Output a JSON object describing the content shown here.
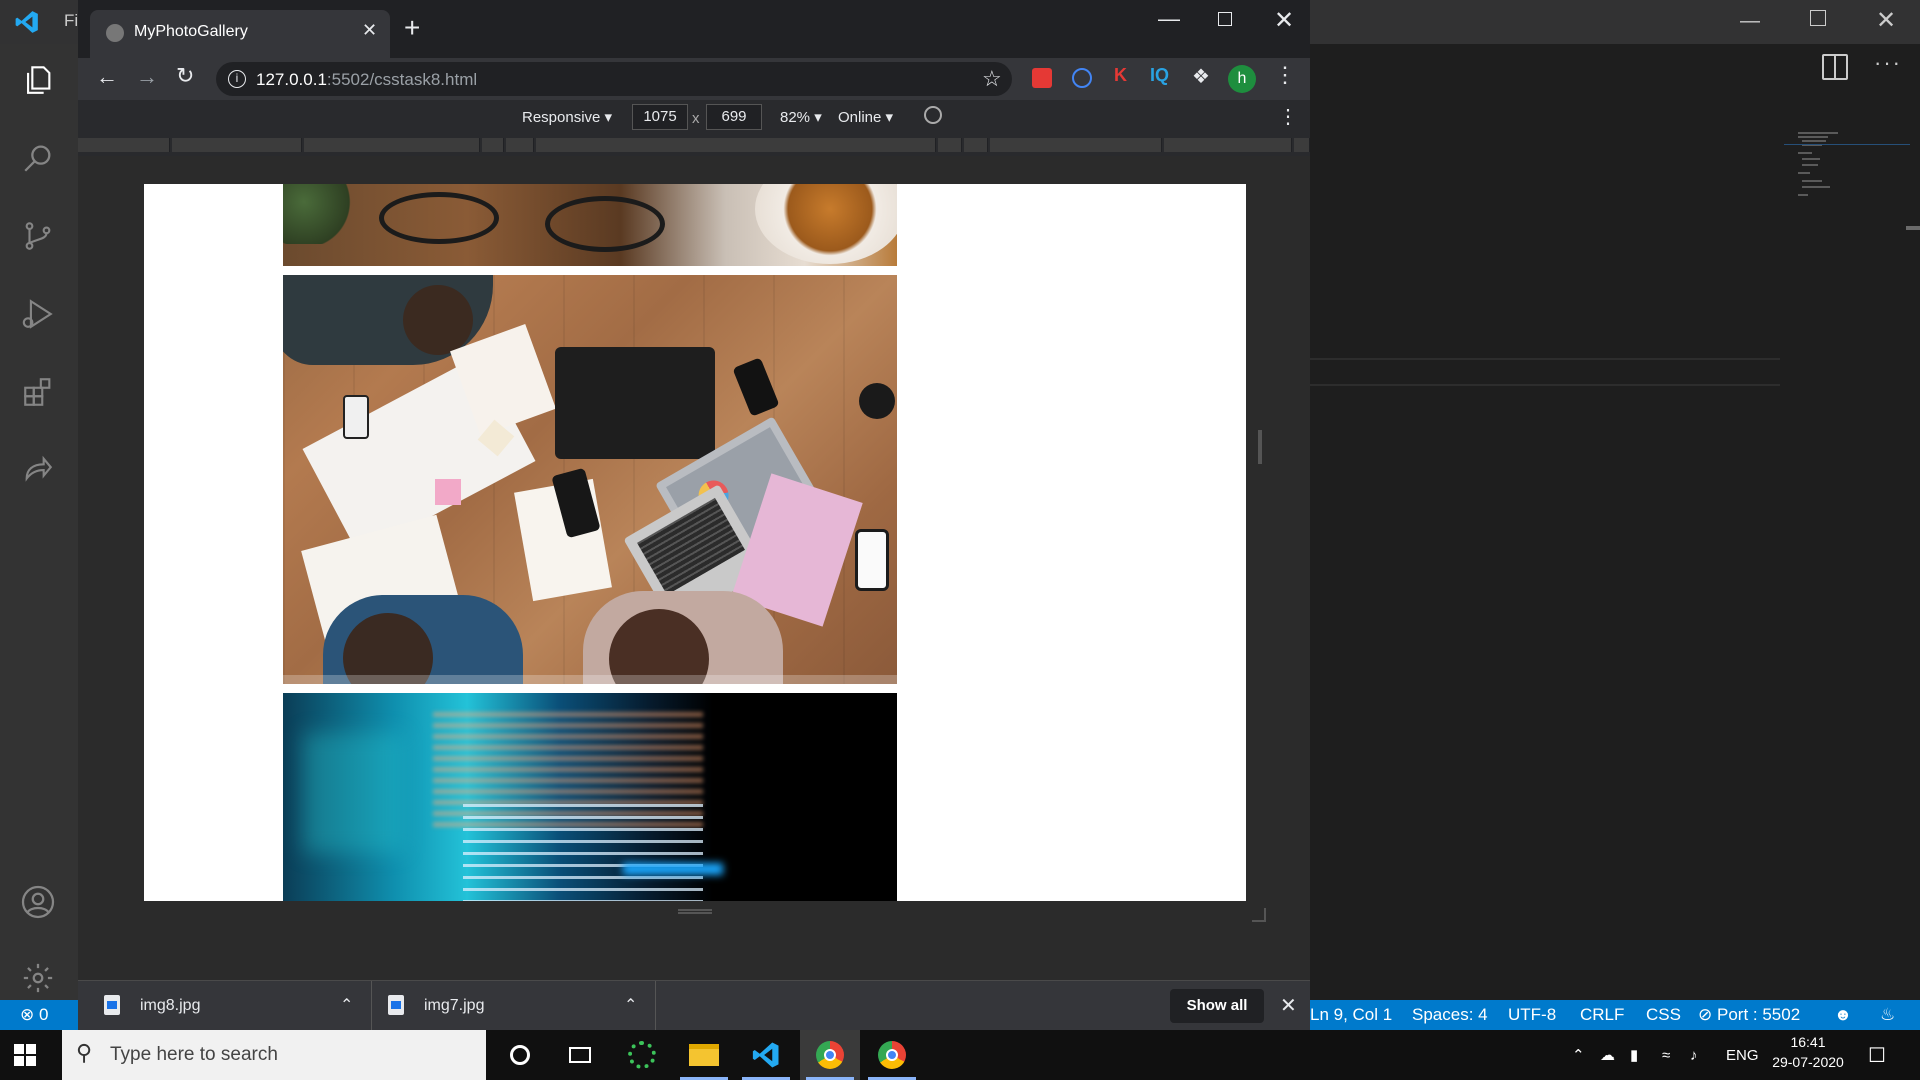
{
  "vscode": {
    "title_partial": "Fi",
    "statusbar": {
      "errors": "0",
      "cursor": "Ln 9, Col 1",
      "spaces": "Spaces: 4",
      "encoding": "UTF-8",
      "eol": "CRLF",
      "language": "CSS",
      "port": "Port : 5502"
    }
  },
  "browser": {
    "tab_title": "MyPhotoGallery",
    "url_host": "127.0.0.1",
    "url_rest": ":5502/csstask8.html",
    "profile_initial": "h",
    "devtools": {
      "device": "Responsive",
      "width": "1075",
      "times": "x",
      "height": "699",
      "zoom": "82%",
      "network": "Online"
    },
    "downloads": [
      {
        "name": "img8.jpg"
      },
      {
        "name": "img7.jpg"
      }
    ],
    "show_all": "Show all"
  },
  "taskbar": {
    "search_placeholder": "Type here to search",
    "language": "ENG",
    "time": "16:41",
    "date": "29-07-2020"
  },
  "colors": {
    "accent": "#007acc",
    "profile": "#1e8e3e"
  }
}
